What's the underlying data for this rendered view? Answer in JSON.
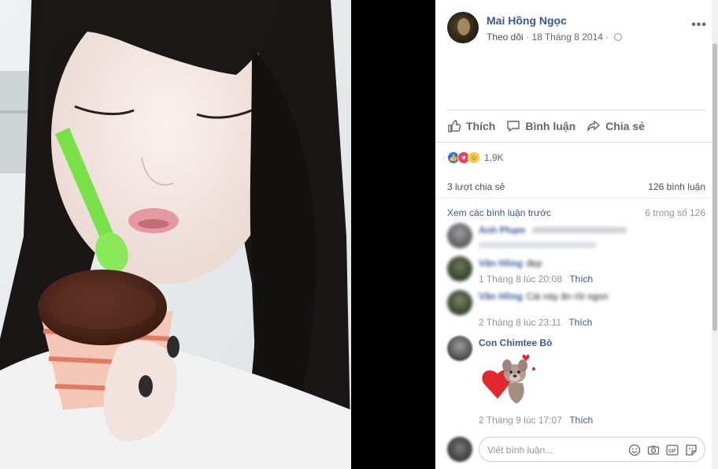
{
  "post": {
    "author": "Mai Hồng Ngọc",
    "follow_label": "Theo dõi",
    "separator": "·",
    "date": "18 Tháng 8 2014",
    "more_label": "•••"
  },
  "actions": {
    "like_label": "Thích",
    "comment_label": "Bình luận",
    "share_label": "Chia sẻ"
  },
  "stats": {
    "reaction_count": "1,9K",
    "reaction_types": [
      "like-icon",
      "love-icon",
      "haha-icon"
    ],
    "shares": "3 lượt chia sẻ",
    "comments": "126 bình luận"
  },
  "comments_header": {
    "view_previous": "Xem các bình luận trước",
    "position": "6 trong số 126"
  },
  "comments": [
    {
      "name": "Anh Phạm",
      "text": "",
      "time": "",
      "like_label": "",
      "blurred": true
    },
    {
      "name": "Vân Hồng",
      "text": "đẹp",
      "time": "1 Tháng 8 lúc 20:08",
      "like_label": "Thích",
      "blurred": true
    },
    {
      "name": "Vân Hồng",
      "text": "Cái này ăn rồi ngon",
      "time": "2 Tháng 8 lúc 23:11",
      "like_label": "Thích",
      "blurred": true
    },
    {
      "name": "Con Chimtee Bò",
      "text": "",
      "time": "2 Tháng 9 lúc 17:07",
      "like_label": "Thích",
      "blurred": false,
      "sticker": "bear-heart-sticker"
    }
  ],
  "composer": {
    "placeholder": "Viết bình luận...",
    "icons": [
      "emoji-icon",
      "camera-icon",
      "gif-icon",
      "sticker-icon"
    ]
  },
  "colors": {
    "link": "#365899",
    "meta": "#616770",
    "like_blue": "#2078f4",
    "love_red": "#f33e58",
    "haha_yellow": "#fbcd44"
  }
}
